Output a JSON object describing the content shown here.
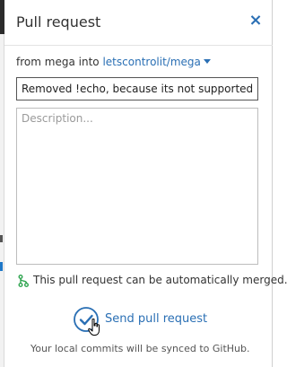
{
  "panel": {
    "title": "Pull request",
    "close_icon": "close-icon",
    "close_glyph": "×"
  },
  "branch": {
    "from_label": "from",
    "source_branch": "mega",
    "into_label": "into",
    "target_branch": "letscontrolit/mega",
    "dropdown_icon": "chevron-down-icon"
  },
  "form": {
    "title_value": "Removed !echo, because its not supported in Windows",
    "description_placeholder": "Description...",
    "description_value": ""
  },
  "merge_status": {
    "icon": "merge-icon",
    "text": "This pull request can be automatically merged.",
    "color": "#2ea44f"
  },
  "send": {
    "icon": "check-circle-icon",
    "label": "Send pull request"
  },
  "sync_note": "Your local commits will be synced to GitHub.",
  "colors": {
    "accent": "#2a6fb4",
    "merge_green": "#2ea44f",
    "text": "#333333"
  }
}
